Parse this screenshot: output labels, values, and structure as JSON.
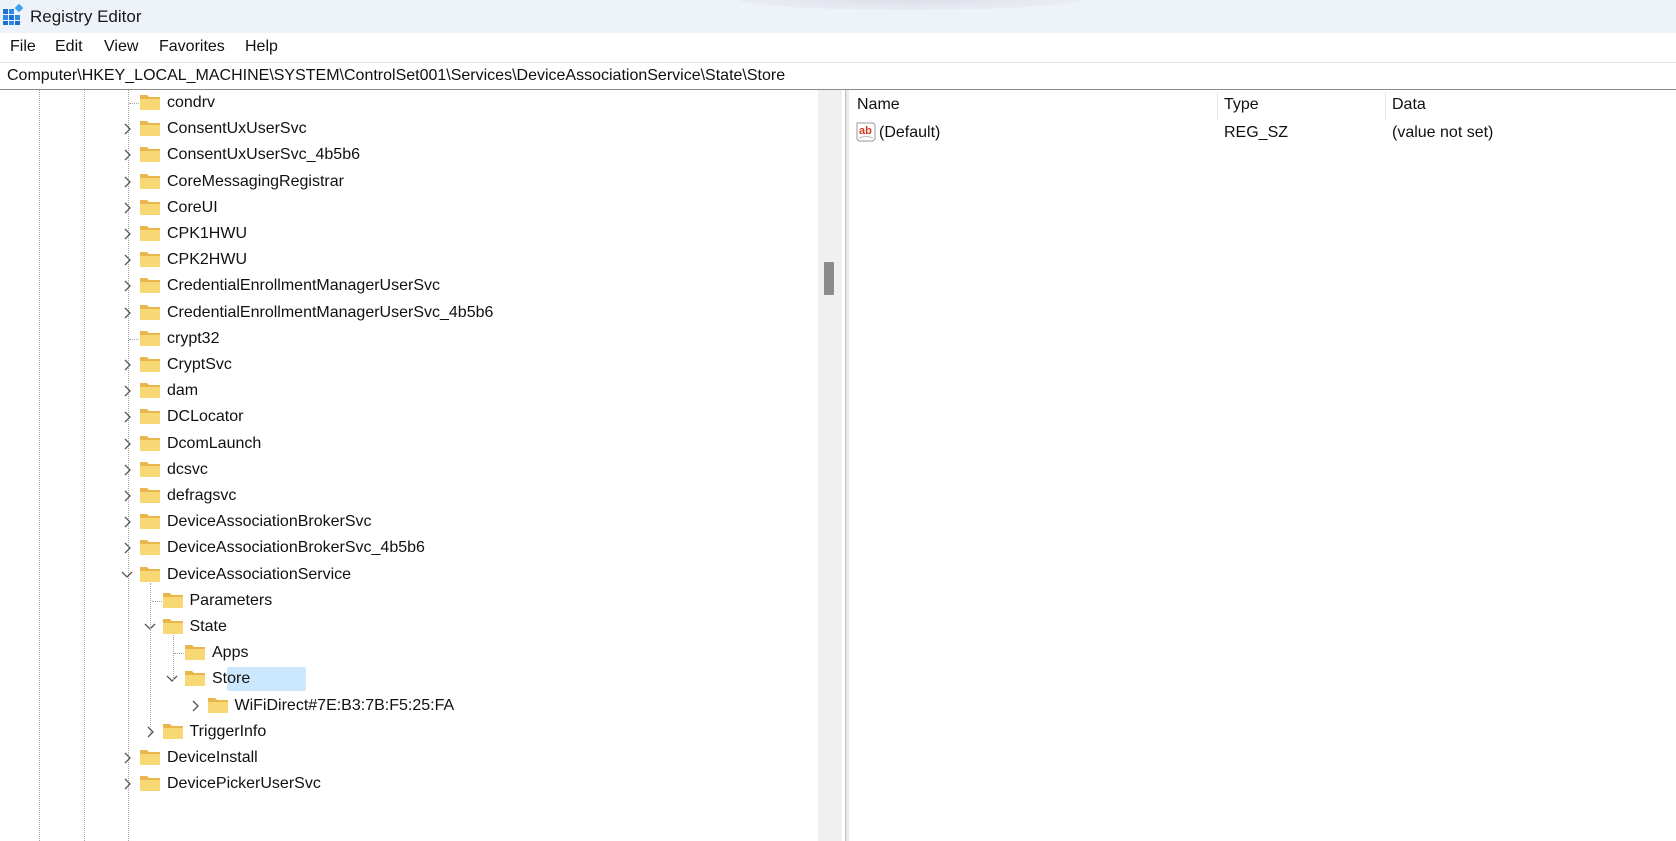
{
  "window": {
    "title": "Registry Editor"
  },
  "menu": [
    "File",
    "Edit",
    "View",
    "Favorites",
    "Help"
  ],
  "address": {
    "path": "Computer\\HKEY_LOCAL_MACHINE\\SYSTEM\\ControlSet001\\Services\\DeviceAssociationService\\State\\Store"
  },
  "tree": [
    {
      "label": "condrv",
      "depth": 0,
      "chevron": "none"
    },
    {
      "label": "ConsentUxUserSvc",
      "depth": 0,
      "chevron": "collapsed"
    },
    {
      "label": "ConsentUxUserSvc_4b5b6",
      "depth": 0,
      "chevron": "collapsed"
    },
    {
      "label": "CoreMessagingRegistrar",
      "depth": 0,
      "chevron": "collapsed"
    },
    {
      "label": "CoreUI",
      "depth": 0,
      "chevron": "collapsed"
    },
    {
      "label": "CPK1HWU",
      "depth": 0,
      "chevron": "collapsed"
    },
    {
      "label": "CPK2HWU",
      "depth": 0,
      "chevron": "collapsed"
    },
    {
      "label": "CredentialEnrollmentManagerUserSvc",
      "depth": 0,
      "chevron": "collapsed"
    },
    {
      "label": "CredentialEnrollmentManagerUserSvc_4b5b6",
      "depth": 0,
      "chevron": "collapsed"
    },
    {
      "label": "crypt32",
      "depth": 0,
      "chevron": "none"
    },
    {
      "label": "CryptSvc",
      "depth": 0,
      "chevron": "collapsed"
    },
    {
      "label": "dam",
      "depth": 0,
      "chevron": "collapsed"
    },
    {
      "label": "DCLocator",
      "depth": 0,
      "chevron": "collapsed"
    },
    {
      "label": "DcomLaunch",
      "depth": 0,
      "chevron": "collapsed"
    },
    {
      "label": "dcsvc",
      "depth": 0,
      "chevron": "collapsed"
    },
    {
      "label": "defragsvc",
      "depth": 0,
      "chevron": "collapsed"
    },
    {
      "label": "DeviceAssociationBrokerSvc",
      "depth": 0,
      "chevron": "collapsed"
    },
    {
      "label": "DeviceAssociationBrokerSvc_4b5b6",
      "depth": 0,
      "chevron": "collapsed"
    },
    {
      "label": "DeviceAssociationService",
      "depth": 0,
      "chevron": "expanded"
    },
    {
      "label": "Parameters",
      "depth": 1,
      "chevron": "none"
    },
    {
      "label": "State",
      "depth": 1,
      "chevron": "expanded"
    },
    {
      "label": "Apps",
      "depth": 2,
      "chevron": "none"
    },
    {
      "label": "Store",
      "depth": 2,
      "chevron": "expanded",
      "selected": true
    },
    {
      "label": "WiFiDirect#7E:B3:7B:F5:25:FA",
      "depth": 3,
      "chevron": "collapsed"
    },
    {
      "label": "TriggerInfo",
      "depth": 1,
      "chevron": "collapsed"
    },
    {
      "label": "DeviceInstall",
      "depth": 0,
      "chevron": "collapsed"
    },
    {
      "label": "DevicePickerUserSvc",
      "depth": 0,
      "chevron": "collapsed"
    }
  ],
  "values": {
    "headers": {
      "name": "Name",
      "type": "Type",
      "data": "Data"
    },
    "rows": [
      {
        "icon": "string-value-icon",
        "name": "(Default)",
        "type": "REG_SZ",
        "data": "(value not set)"
      }
    ]
  },
  "colors": {
    "selection": "#cce8ff",
    "folder": "#f8d775",
    "titlebar": "#eef2f9"
  }
}
